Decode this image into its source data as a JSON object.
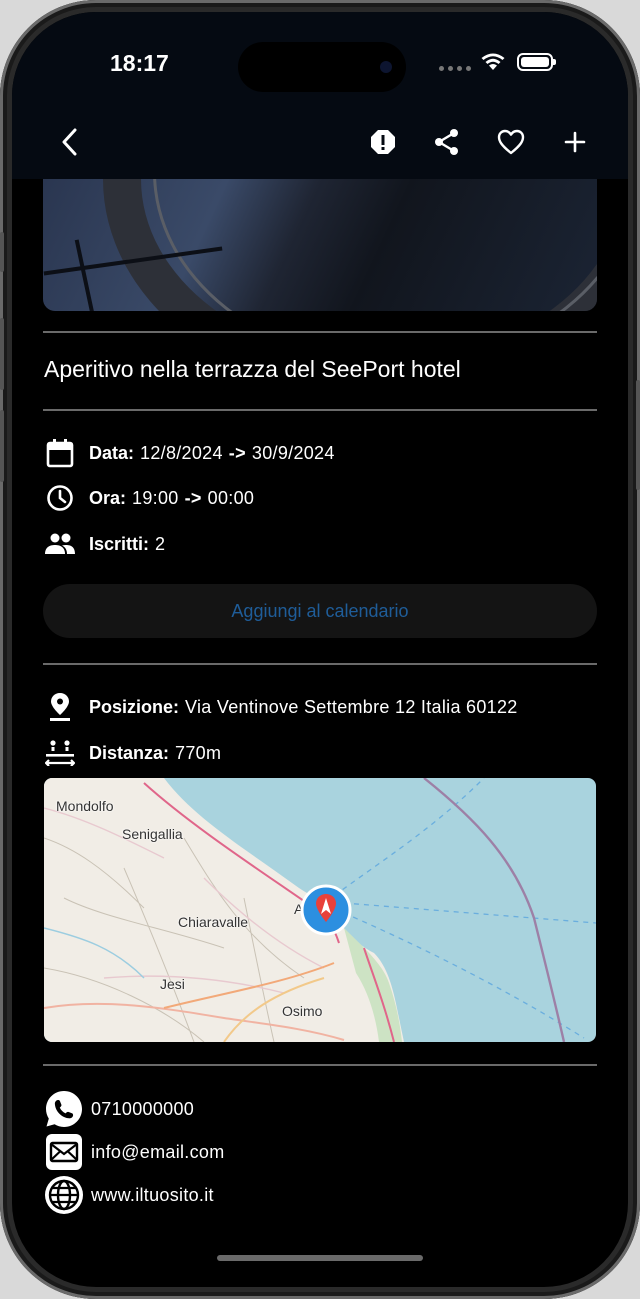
{
  "status_bar": {
    "time": "18:17"
  },
  "nav": {
    "icons": [
      "back-icon",
      "report-icon",
      "share-icon",
      "heart-icon",
      "plus-icon"
    ]
  },
  "event": {
    "title": "Aperitivo nella terrazza del SeePort hotel",
    "date_label": "Data:",
    "date_start": "12/8/2024",
    "date_end": "30/9/2024",
    "time_label": "Ora:",
    "time_start": "19:00",
    "time_end": "00:00",
    "arrow": "->",
    "subscribers_label": "Iscritti:",
    "subscribers_value": "2",
    "calendar_button": "Aggiungi al calendario"
  },
  "location": {
    "position_label": "Posizione:",
    "position_value": "Via Ventinove Settembre 12 Italia 60122",
    "distance_label": "Distanza:",
    "distance_value": "770m"
  },
  "map": {
    "labels": [
      "Mondolfo",
      "Senigallia",
      "Chiaravalle",
      "Jesi",
      "Osimo",
      "Ancona"
    ],
    "sea_color": "#a9d3de",
    "land_color": "#f1ede6",
    "marker_color": "#e8413b",
    "marker_ring_color": "#2c8fe0"
  },
  "contacts": {
    "phone": "0710000000",
    "email": "info@email.com",
    "website": "www.iltuosito.it"
  },
  "colors": {
    "background": "#000000",
    "accent_button_text": "#1f5d99",
    "divider": "#6a6a6a"
  }
}
